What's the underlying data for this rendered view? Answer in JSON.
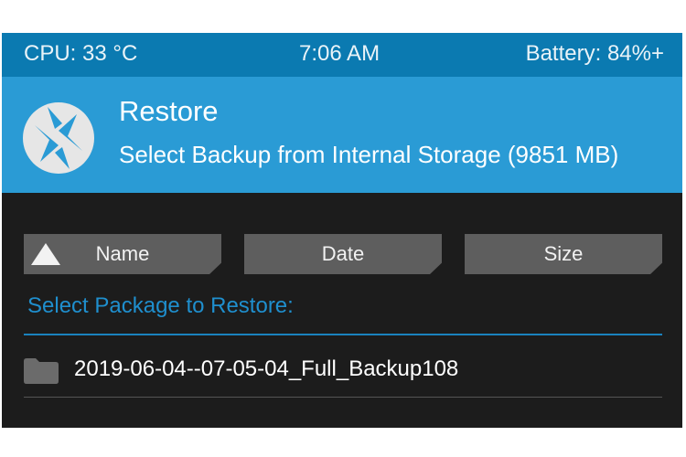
{
  "status": {
    "cpu": "CPU: 33 °C",
    "time": "7:06 AM",
    "battery": "Battery: 84%+"
  },
  "header": {
    "title": "Restore",
    "subtitle": "Select Backup from Internal Storage (9851 MB)",
    "logo_icon": "twrp-logo-icon"
  },
  "sort": {
    "name_label": "Name",
    "date_label": "Date",
    "size_label": "Size",
    "active": "Name",
    "direction_icon": "sort-ascending-triangle-icon"
  },
  "list": {
    "label": "Select Package to Restore:",
    "items": [
      {
        "name": "2019-06-04--07-05-04_Full_Backup108",
        "icon": "folder-icon"
      }
    ]
  },
  "colors": {
    "status_bar": "#0b7ab1",
    "header": "#2a9bd5",
    "background": "#1c1c1c",
    "button": "#5e5e5e",
    "accent_text": "#1f8fce"
  }
}
